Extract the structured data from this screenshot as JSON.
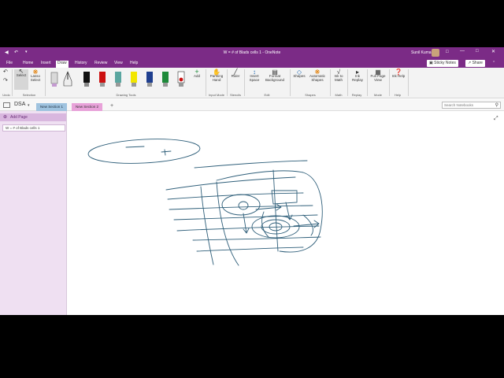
{
  "window": {
    "title": "W = # of Blads cells 1  -  OneNote",
    "user": "Sunil Kumar"
  },
  "menu_tabs": [
    "File",
    "Home",
    "Insert",
    "Draw",
    "History",
    "Review",
    "View",
    "Help"
  ],
  "active_tab": "Draw",
  "top_buttons": {
    "sticky_notes": "Sticky Notes",
    "share": "Share"
  },
  "ribbon": {
    "undo_group": "Undo",
    "select_label": "Select",
    "lasso_label": "Lasso Select",
    "selection_group": "Selection",
    "drawing_tools_group": "Drawing Tools",
    "add_label": "Add",
    "panning_label": "Panning Hand",
    "input_group": "Input Mode",
    "ruler_label": "Ruler",
    "stencils_group": "Stencils",
    "insert_space_label": "Insert Space",
    "format_bg_label": "Format Background",
    "edit_group": "Edit",
    "shapes_label": "Shapes",
    "auto_shapes_label": "Automatic Shapes",
    "shapes_group": "Shapes",
    "ink_to_math_label": "Ink to Math",
    "math_group": "Math",
    "ink_replay_label": "Ink Replay",
    "replay_group": "Replay",
    "full_page_label": "Full Page View",
    "mode_group": "Mode",
    "ink_help_label": "Ink Help",
    "help_group": "Help"
  },
  "pens": [
    {
      "name": "pen-gray",
      "color": "#888888"
    },
    {
      "name": "pen-black-thin",
      "color": "#222222"
    },
    {
      "name": "pen-black",
      "color": "#111111"
    },
    {
      "name": "pen-red",
      "color": "#cc1111"
    },
    {
      "name": "pen-teal",
      "color": "#5aa6a0"
    },
    {
      "name": "highlighter-yellow",
      "color": "#f2e600"
    },
    {
      "name": "pen-blue",
      "color": "#1f3f8f"
    },
    {
      "name": "pen-green",
      "color": "#1e8a3a"
    },
    {
      "name": "pen-red-dot",
      "color": "#cc1111"
    }
  ],
  "notebook": {
    "name": "DSA",
    "sections": [
      "New Section 1",
      "New Section 2"
    ],
    "add_section": "+",
    "search_placeholder": "Search Notebooks"
  },
  "pages": {
    "add_page": "Add Page",
    "items": [
      "W = # of Blads cells 1"
    ]
  }
}
